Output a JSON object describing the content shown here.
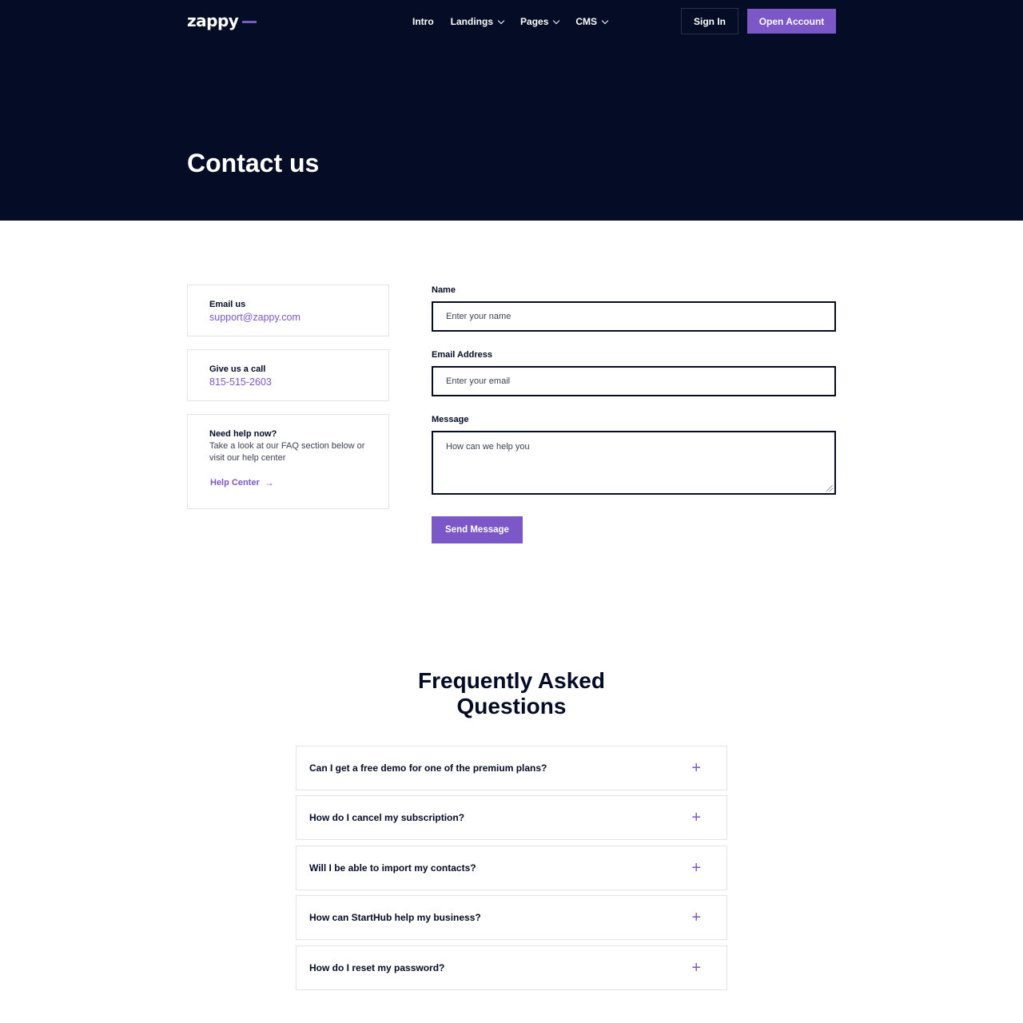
{
  "brand": {
    "logo_text": "zappy",
    "accent": "#7b57c8",
    "dark": "#050c26"
  },
  "nav": {
    "items": [
      {
        "label": "Intro"
      },
      {
        "label": "Landings"
      },
      {
        "label": "Pages"
      },
      {
        "label": "CMS"
      }
    ],
    "signin_label": "Sign In",
    "open_account_label": "Open Account"
  },
  "hero": {
    "title": "Contact us"
  },
  "contact": {
    "email": {
      "title": "Email us",
      "value": "support@zappy.com"
    },
    "phone": {
      "title": "Give us a call",
      "value": "815-515-2603"
    },
    "help": {
      "title": "Need help now?",
      "text": "Take a look at our FAQ section below or visit our help center",
      "link_label": "Help Center"
    }
  },
  "form": {
    "name_label": "Name",
    "name_placeholder": "Enter your name",
    "email_label": "Email Address",
    "email_placeholder": "Enter your email",
    "message_label": "Message",
    "message_placeholder": "How can we help you",
    "submit_label": "Send Message"
  },
  "faq": {
    "title_line1": "Frequently Asked",
    "title_line2": "Questions",
    "items": [
      {
        "question": "Can I get a free demo for one of the premium plans?"
      },
      {
        "question": "How do I cancel my subscription?"
      },
      {
        "question": "Will I be able to import my contacts?"
      },
      {
        "question": "How can StartHub help my business?"
      },
      {
        "question": "How do I reset my password?"
      }
    ]
  }
}
